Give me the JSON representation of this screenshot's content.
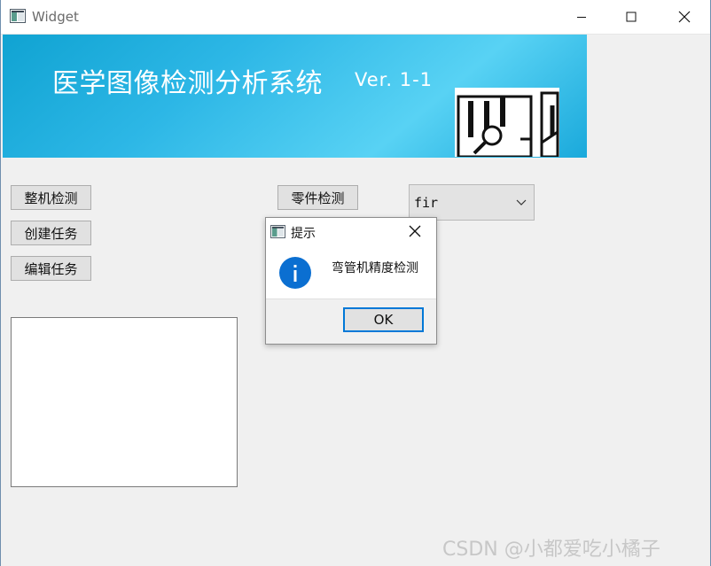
{
  "window": {
    "title": "Widget",
    "controls": {
      "minimize": "minimize",
      "maximize": "maximize",
      "close": "close"
    }
  },
  "banner": {
    "title": "医学图像检测分析系统",
    "version": "Ver. 1-1"
  },
  "buttons": {
    "whole_check": "整机检测",
    "create_task": "创建任务",
    "edit_task": "编辑任务",
    "part_check": "零件检测"
  },
  "dropdown": {
    "value": "fir"
  },
  "dialog": {
    "title": "提示",
    "message": "弯管机精度检测",
    "ok": "OK"
  },
  "watermark": "CSDN @小都爱吃小橘子",
  "colors": {
    "banner_start": "#10a3d2",
    "banner_end": "#58d2f4",
    "accent": "#0078d7",
    "info_icon": "#0b6fd1"
  },
  "icons": {
    "app": "app-window-icon",
    "dialog": "app-window-icon",
    "info": "info-icon",
    "dropdown": "chevron-down-icon"
  }
}
